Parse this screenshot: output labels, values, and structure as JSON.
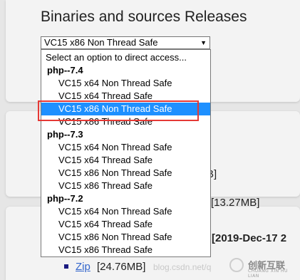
{
  "header": {
    "title": "Binaries and sources Releases"
  },
  "select": {
    "value": "VC15 x86 Non Thread Safe",
    "arrow": "▼"
  },
  "dropdown": {
    "placeholder": "Select an option to direct access...",
    "groups": [
      {
        "label": "php--7.4",
        "items": [
          "VC15 x64 Non Thread Safe",
          "VC15 x64 Thread Safe",
          "VC15 x86 Non Thread Safe",
          "VC15 x86 Thread Safe"
        ]
      },
      {
        "label": "php--7.3",
        "items": [
          "VC15 x64 Non Thread Safe",
          "VC15 x64 Thread Safe",
          "VC15 x86 Non Thread Safe",
          "VC15 x86 Thread Safe"
        ]
      },
      {
        "label": "php--7.2",
        "items": [
          "VC15 x64 Non Thread Safe",
          "VC15 x64 Thread Safe",
          "VC15 x86 Non Thread Safe",
          "VC15 x86 Thread Safe"
        ]
      }
    ],
    "selected_group": 0,
    "selected_item": 2
  },
  "background": {
    "bracket_partial": "B]",
    "size_1": "[13.27MB]",
    "date_partial": "[2019-Dec-17 2",
    "zip_label": "Zip",
    "zip_size": "[24.76MB]"
  },
  "watermark": {
    "url": "blog.csdn.net/q",
    "brand": "创新互联",
    "brand_sub": "CHUANG XIN HU LIAN"
  },
  "colors": {
    "selected_bg": "#1e90ff",
    "highlight_border": "#e53935",
    "link": "#3366cc"
  }
}
